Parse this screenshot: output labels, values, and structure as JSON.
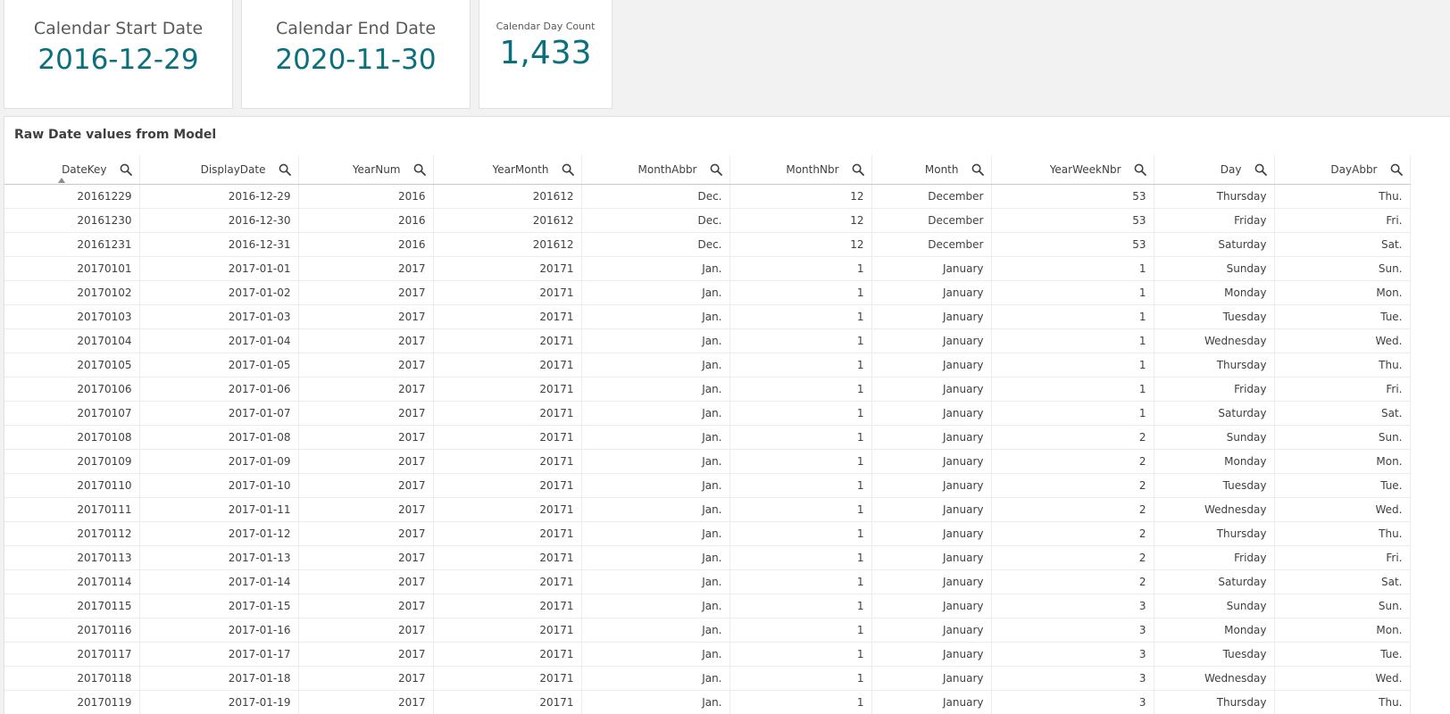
{
  "kpis": {
    "start": {
      "label": "Calendar Start Date",
      "value": "2016-12-29"
    },
    "end": {
      "label": "Calendar End Date",
      "value": "2020-11-30"
    },
    "count": {
      "label": "Calendar Day Count",
      "value": "1,433"
    }
  },
  "table": {
    "title": "Raw Date values from Model",
    "sorted_column": "DateKey",
    "columns": [
      "DateKey",
      "DisplayDate",
      "YearNum",
      "YearMonth",
      "MonthAbbr",
      "MonthNbr",
      "Month",
      "YearWeekNbr",
      "Day",
      "DayAbbr"
    ],
    "rows": [
      [
        "20161229",
        "2016-12-29",
        "2016",
        "201612",
        "Dec.",
        "12",
        "December",
        "53",
        "Thursday",
        "Thu."
      ],
      [
        "20161230",
        "2016-12-30",
        "2016",
        "201612",
        "Dec.",
        "12",
        "December",
        "53",
        "Friday",
        "Fri."
      ],
      [
        "20161231",
        "2016-12-31",
        "2016",
        "201612",
        "Dec.",
        "12",
        "December",
        "53",
        "Saturday",
        "Sat."
      ],
      [
        "20170101",
        "2017-01-01",
        "2017",
        "20171",
        "Jan.",
        "1",
        "January",
        "1",
        "Sunday",
        "Sun."
      ],
      [
        "20170102",
        "2017-01-02",
        "2017",
        "20171",
        "Jan.",
        "1",
        "January",
        "1",
        "Monday",
        "Mon."
      ],
      [
        "20170103",
        "2017-01-03",
        "2017",
        "20171",
        "Jan.",
        "1",
        "January",
        "1",
        "Tuesday",
        "Tue."
      ],
      [
        "20170104",
        "2017-01-04",
        "2017",
        "20171",
        "Jan.",
        "1",
        "January",
        "1",
        "Wednesday",
        "Wed."
      ],
      [
        "20170105",
        "2017-01-05",
        "2017",
        "20171",
        "Jan.",
        "1",
        "January",
        "1",
        "Thursday",
        "Thu."
      ],
      [
        "20170106",
        "2017-01-06",
        "2017",
        "20171",
        "Jan.",
        "1",
        "January",
        "1",
        "Friday",
        "Fri."
      ],
      [
        "20170107",
        "2017-01-07",
        "2017",
        "20171",
        "Jan.",
        "1",
        "January",
        "1",
        "Saturday",
        "Sat."
      ],
      [
        "20170108",
        "2017-01-08",
        "2017",
        "20171",
        "Jan.",
        "1",
        "January",
        "2",
        "Sunday",
        "Sun."
      ],
      [
        "20170109",
        "2017-01-09",
        "2017",
        "20171",
        "Jan.",
        "1",
        "January",
        "2",
        "Monday",
        "Mon."
      ],
      [
        "20170110",
        "2017-01-10",
        "2017",
        "20171",
        "Jan.",
        "1",
        "January",
        "2",
        "Tuesday",
        "Tue."
      ],
      [
        "20170111",
        "2017-01-11",
        "2017",
        "20171",
        "Jan.",
        "1",
        "January",
        "2",
        "Wednesday",
        "Wed."
      ],
      [
        "20170112",
        "2017-01-12",
        "2017",
        "20171",
        "Jan.",
        "1",
        "January",
        "2",
        "Thursday",
        "Thu."
      ],
      [
        "20170113",
        "2017-01-13",
        "2017",
        "20171",
        "Jan.",
        "1",
        "January",
        "2",
        "Friday",
        "Fri."
      ],
      [
        "20170114",
        "2017-01-14",
        "2017",
        "20171",
        "Jan.",
        "1",
        "January",
        "2",
        "Saturday",
        "Sat."
      ],
      [
        "20170115",
        "2017-01-15",
        "2017",
        "20171",
        "Jan.",
        "1",
        "January",
        "3",
        "Sunday",
        "Sun."
      ],
      [
        "20170116",
        "2017-01-16",
        "2017",
        "20171",
        "Jan.",
        "1",
        "January",
        "3",
        "Monday",
        "Mon."
      ],
      [
        "20170117",
        "2017-01-17",
        "2017",
        "20171",
        "Jan.",
        "1",
        "January",
        "3",
        "Tuesday",
        "Tue."
      ],
      [
        "20170118",
        "2017-01-18",
        "2017",
        "20171",
        "Jan.",
        "1",
        "January",
        "3",
        "Wednesday",
        "Wed."
      ],
      [
        "20170119",
        "2017-01-19",
        "2017",
        "20171",
        "Jan.",
        "1",
        "January",
        "3",
        "Thursday",
        "Thu."
      ]
    ]
  },
  "icons": {
    "column_search": "search-icon",
    "sort": "sort-ascending-icon"
  },
  "colors": {
    "kpi_value": "#0c6f7e",
    "background": "#f2f2f2"
  }
}
